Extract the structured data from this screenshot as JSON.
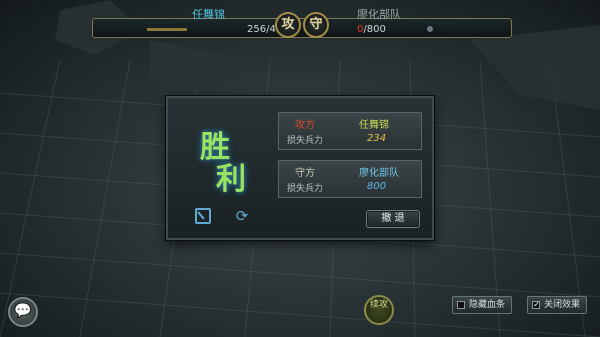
{
  "battle": {
    "attacker": {
      "name": "任舞锦",
      "troops": "256/490"
    },
    "defender": {
      "name": "廖化部队",
      "troops_zero": "0",
      "troops_total": "/800"
    },
    "attack_badge": "攻",
    "defend_badge": "守"
  },
  "result": {
    "victory_char1": "胜",
    "victory_char2": "利",
    "attacker_panel": {
      "side": "攻方",
      "name": "任舞锦",
      "loss_label": "损失兵力",
      "loss_value": "234"
    },
    "defender_panel": {
      "side": "守方",
      "name": "廖化部队",
      "loss_label": "损失兵力",
      "loss_value": "800"
    },
    "leave_label": "撤 退",
    "share_icon": "share-icon",
    "replay_icon": "replay-icon"
  },
  "bottom": {
    "chat_icon": "chat-bubble-icon",
    "round_label": "续攻",
    "hide_option_label": "隐藏血条",
    "close_effects_label": "关闭效果"
  },
  "colors": {
    "accent_cyan": "#4fc0dd",
    "victory_green": "#9be35f",
    "gold": "#a48f48"
  }
}
